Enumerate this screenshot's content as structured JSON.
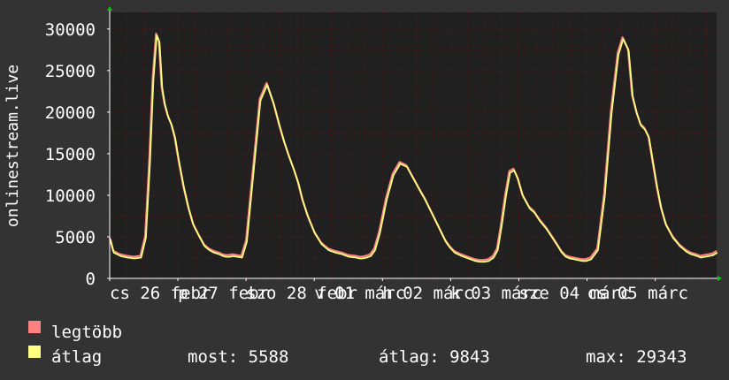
{
  "chart_data": {
    "type": "area",
    "ylabel": "onlinestream.live",
    "ylim": [
      0,
      32000
    ],
    "yticks": [
      0,
      5000,
      10000,
      15000,
      20000,
      25000,
      30000
    ],
    "grid": true,
    "colors": {
      "background": "#333333",
      "plot_bg": "#202020",
      "grid": "#5a1a1a",
      "axis": "#ffffff",
      "arrow": "#00cc00"
    },
    "x_range_days": [
      0,
      8.9
    ],
    "x_tick_labels": [
      {
        "label": "cs 26 febr",
        "day": 0
      },
      {
        "label": "p 27 febr",
        "day": 1
      },
      {
        "label": "szo 28 febr",
        "day": 2
      },
      {
        "label": "v 01 márc",
        "day": 3
      },
      {
        "label": "h 02 márc",
        "day": 4
      },
      {
        "label": "k 03 márc",
        "day": 5
      },
      {
        "label": "sze 04 márc",
        "day": 6
      },
      {
        "label": "cs 05 márc",
        "day": 7
      }
    ],
    "series": [
      {
        "name": "legtöbb",
        "color": "#ff8080",
        "x": [
          0,
          0.05,
          0.15,
          0.25,
          0.35,
          0.45,
          0.52,
          0.58,
          0.63,
          0.68,
          0.72,
          0.76,
          0.8,
          0.85,
          0.9,
          0.95,
          1.0,
          1.08,
          1.15,
          1.22,
          1.3,
          1.38,
          1.45,
          1.52,
          1.6,
          1.65,
          1.7,
          1.75,
          1.8,
          1.86,
          1.93,
          2.0,
          2.1,
          2.2,
          2.3,
          2.4,
          2.48,
          2.55,
          2.62,
          2.7,
          2.76,
          2.82,
          2.9,
          3.0,
          3.1,
          3.2,
          3.3,
          3.4,
          3.5,
          3.6,
          3.66,
          3.7,
          3.76,
          3.82,
          3.88,
          3.95,
          4.05,
          4.15,
          4.25,
          4.35,
          4.45,
          4.55,
          4.62,
          4.68,
          4.74,
          4.8,
          4.86,
          4.92,
          4.98,
          5.05,
          5.15,
          5.25,
          5.35,
          5.42,
          5.48,
          5.55,
          5.62,
          5.68,
          5.74,
          5.8,
          5.86,
          5.92,
          5.98,
          6.05,
          6.15,
          6.22,
          6.3,
          6.4,
          6.48,
          6.56,
          6.62,
          6.68,
          6.74,
          6.8,
          6.86,
          6.92,
          6.98,
          7.05,
          7.15,
          7.25,
          7.35,
          7.45,
          7.52,
          7.6,
          7.66,
          7.72,
          7.78,
          7.84,
          7.9,
          7.96,
          8.02,
          8.08,
          8.15,
          8.25,
          8.35,
          8.45,
          8.52,
          8.6,
          8.66,
          8.72,
          8.78,
          8.84,
          8.9
        ],
        "values": [
          4800,
          3200,
          2800,
          2600,
          2500,
          2600,
          5000,
          14000,
          24000,
          29343,
          28500,
          23000,
          21000,
          19500,
          18500,
          17000,
          14500,
          11000,
          8500,
          6500,
          5200,
          4000,
          3500,
          3200,
          3000,
          2800,
          2700,
          2700,
          2800,
          2700,
          2600,
          4500,
          13000,
          21500,
          23400,
          21000,
          18500,
          16500,
          14800,
          13000,
          11500,
          9500,
          7500,
          5500,
          4200,
          3500,
          3200,
          3000,
          2700,
          2600,
          2500,
          2500,
          2600,
          2800,
          3500,
          5500,
          9500,
          12500,
          13900,
          13500,
          12000,
          10500,
          9500,
          8500,
          7500,
          6500,
          5500,
          4500,
          3800,
          3200,
          2800,
          2500,
          2200,
          2100,
          2100,
          2200,
          2600,
          3500,
          6500,
          10000,
          12800,
          13100,
          12000,
          10000,
          8500,
          8000,
          7000,
          6000,
          5000,
          4000,
          3200,
          2700,
          2500,
          2400,
          2300,
          2200,
          2200,
          2400,
          3500,
          10000,
          20000,
          27000,
          28900,
          27500,
          22000,
          20000,
          18500,
          18000,
          17000,
          14000,
          11000,
          8500,
          6500,
          5000,
          4000,
          3300,
          3000,
          2800,
          2600,
          2700,
          2800,
          2900,
          3200
        ]
      },
      {
        "name": "átlag",
        "color": "#ffff80"
      }
    ],
    "legend": {
      "placement": "bottom-left",
      "stats": [
        {
          "label": "most:",
          "value": "5588"
        },
        {
          "label": "átlag:",
          "value": "9843"
        },
        {
          "label": "max:",
          "value": "29343"
        }
      ]
    }
  }
}
